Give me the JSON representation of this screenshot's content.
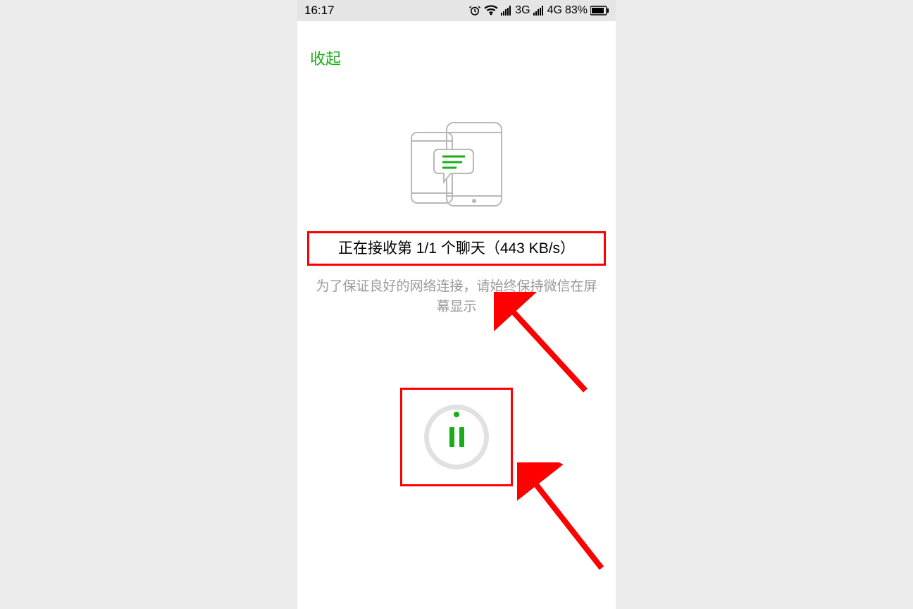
{
  "statusbar": {
    "time": "16:17",
    "net3g": "3G",
    "net4g": "4G",
    "battery": "83%"
  },
  "header": {
    "collapse": "收起"
  },
  "transfer": {
    "status": "正在接收第 1/1 个聊天（443 KB/s）",
    "hint": "为了保证良好的网络连接，请始终保持微信在屏幕显示"
  }
}
